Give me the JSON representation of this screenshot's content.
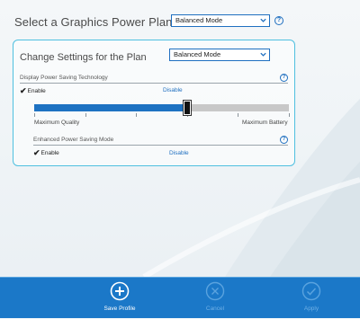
{
  "header": {
    "title": "Select a Graphics Power Plan",
    "plan_select": {
      "value": "Balanced Mode"
    }
  },
  "panel": {
    "title": "Change Settings for the Plan",
    "plan_select": {
      "value": "Balanced Mode"
    },
    "display_power_saving": {
      "label": "Display Power Saving Technology",
      "enable_label": "Enable",
      "disable_label": "Disable",
      "selected": "Enable",
      "slider": {
        "min_label": "Maximum Quality",
        "max_label": "Maximum Battery",
        "value_fraction": 0.6,
        "tick_count": 6
      }
    },
    "enhanced_power_saving": {
      "label": "Enhanced Power Saving Mode",
      "enable_label": "Enable",
      "disable_label": "Disable",
      "selected": "Enable"
    }
  },
  "help_icon_text": "?",
  "footer": {
    "save_label": "Save Profile",
    "cancel_label": "Cancel",
    "apply_label": "Apply"
  },
  "colors": {
    "accent": "#1f6fc0",
    "footer_bg": "#1b78c8",
    "panel_border": "#4fc0e0",
    "slider_fill": "#1d72c2",
    "slider_track": "#c8c8c8"
  },
  "icons": {
    "select_chevron": "chevron-down-icon",
    "help": "help-icon",
    "save": "plus-circle-icon",
    "cancel": "x-circle-icon",
    "apply": "check-circle-icon"
  }
}
